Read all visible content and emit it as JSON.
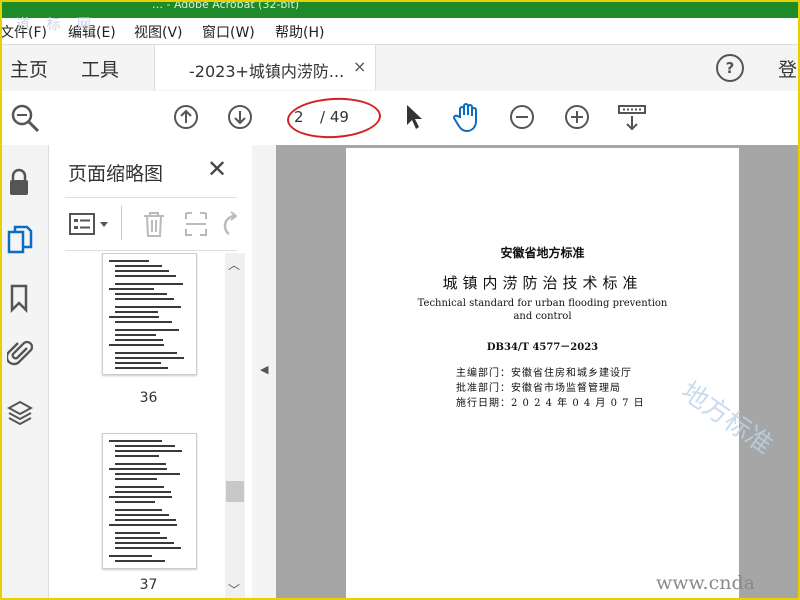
{
  "window": {
    "title_fragment": "… - Adobe Acrobat (32-bit)",
    "watermark_top": "道 标 网"
  },
  "menu": [
    {
      "label": "文件(F)"
    },
    {
      "label": "编辑(E)"
    },
    {
      "label": "视图(V)"
    },
    {
      "label": "窗口(W)"
    },
    {
      "label": "帮助(H)"
    }
  ],
  "tabs": {
    "home": "主页",
    "tools": "工具",
    "document": "-2023+城镇内涝防...",
    "close": "×",
    "help": "?",
    "login": "登"
  },
  "toolbar": {
    "page_current": "2",
    "page_total": "/ 49"
  },
  "sidebar": {
    "title": "页面缩略图",
    "close": "✕"
  },
  "thumbnails": [
    {
      "label": "36"
    },
    {
      "label": "37"
    }
  ],
  "document": {
    "org": "安徽省地方标准",
    "title_cn": "城镇内涝防治技术标准",
    "title_en_1": "Technical standard for urban flooding prevention",
    "title_en_2": "and control",
    "code": "DB34/T 4577－2023",
    "editor": "主编部门：安徽省住房和城乡建设厅",
    "approver": "批准部门：安徽省市场监督管理局",
    "date": "施行日期：2 0 2 4 年 0 4 月 0 7 日"
  },
  "watermarks": {
    "page": "地方标准",
    "url": "www.cnda"
  },
  "colors": {
    "titlebar": "#1f8a2a",
    "frame": "#e6d200",
    "annotation": "#d42020",
    "accent": "#0b6cc4",
    "viewer_bg": "#a6a6a6"
  }
}
